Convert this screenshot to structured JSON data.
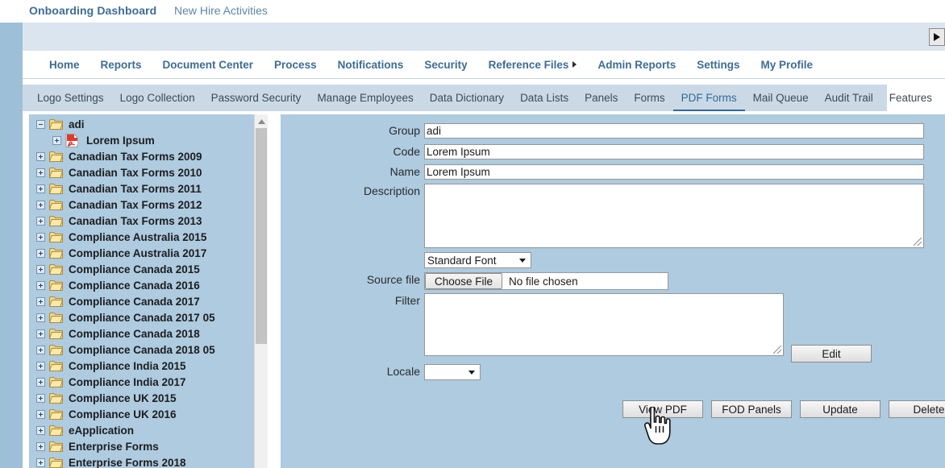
{
  "titlebar": {
    "app_title": "Onboarding Dashboard",
    "secondary_title": "New Hire Activities",
    "scroll_right_icon": "play-right-icon"
  },
  "main_nav": {
    "items": [
      {
        "label": "Home",
        "has_caret": false
      },
      {
        "label": "Reports",
        "has_caret": false
      },
      {
        "label": "Document Center",
        "has_caret": false
      },
      {
        "label": "Process",
        "has_caret": false
      },
      {
        "label": "Notifications",
        "has_caret": false
      },
      {
        "label": "Security",
        "has_caret": false
      },
      {
        "label": "Reference Files",
        "has_caret": true
      },
      {
        "label": "Admin Reports",
        "has_caret": false
      },
      {
        "label": "Settings",
        "has_caret": false
      },
      {
        "label": "My Profile",
        "has_caret": false
      }
    ]
  },
  "sub_tabs": {
    "active": "PDF Forms",
    "items": [
      "Logo Settings",
      "Logo Collection",
      "Password Security",
      "Manage Employees",
      "Data Dictionary",
      "Data Lists",
      "Panels",
      "Forms",
      "PDF Forms",
      "Mail Queue",
      "Audit Trail",
      "Features"
    ]
  },
  "tree": {
    "nodes": [
      {
        "label": "adi",
        "type": "folder",
        "toggle": "minus",
        "indent": 0
      },
      {
        "label": "Lorem Ipsum",
        "type": "pdf",
        "toggle": "plus",
        "indent": 1
      },
      {
        "label": "Canadian Tax Forms 2009",
        "type": "folder",
        "toggle": "plus",
        "indent": 0
      },
      {
        "label": "Canadian Tax Forms 2010",
        "type": "folder",
        "toggle": "plus",
        "indent": 0
      },
      {
        "label": "Canadian Tax Forms 2011",
        "type": "folder",
        "toggle": "plus",
        "indent": 0
      },
      {
        "label": "Canadian Tax Forms 2012",
        "type": "folder",
        "toggle": "plus",
        "indent": 0
      },
      {
        "label": "Canadian Tax Forms 2013",
        "type": "folder",
        "toggle": "plus",
        "indent": 0
      },
      {
        "label": "Compliance Australia 2015",
        "type": "folder",
        "toggle": "plus",
        "indent": 0
      },
      {
        "label": "Compliance Australia 2017",
        "type": "folder",
        "toggle": "plus",
        "indent": 0
      },
      {
        "label": "Compliance Canada 2015",
        "type": "folder",
        "toggle": "plus",
        "indent": 0
      },
      {
        "label": "Compliance Canada 2016",
        "type": "folder",
        "toggle": "plus",
        "indent": 0
      },
      {
        "label": "Compliance Canada 2017",
        "type": "folder",
        "toggle": "plus",
        "indent": 0
      },
      {
        "label": "Compliance Canada 2017 05",
        "type": "folder",
        "toggle": "plus",
        "indent": 0
      },
      {
        "label": "Compliance Canada 2018",
        "type": "folder",
        "toggle": "plus",
        "indent": 0
      },
      {
        "label": "Compliance Canada 2018 05",
        "type": "folder",
        "toggle": "plus",
        "indent": 0
      },
      {
        "label": "Compliance India 2015",
        "type": "folder",
        "toggle": "plus",
        "indent": 0
      },
      {
        "label": "Compliance India 2017",
        "type": "folder",
        "toggle": "plus",
        "indent": 0
      },
      {
        "label": "Compliance UK 2015",
        "type": "folder",
        "toggle": "plus",
        "indent": 0
      },
      {
        "label": "Compliance UK 2016",
        "type": "folder",
        "toggle": "plus",
        "indent": 0
      },
      {
        "label": "eApplication",
        "type": "folder",
        "toggle": "plus",
        "indent": 0
      },
      {
        "label": "Enterprise Forms",
        "type": "folder",
        "toggle": "plus",
        "indent": 0
      },
      {
        "label": "Enterprise Forms 2018",
        "type": "folder",
        "toggle": "plus",
        "indent": 0
      }
    ],
    "scrollbar": {
      "up_arrow_icon": "triangle-up-icon"
    }
  },
  "form": {
    "group_label": "Group",
    "group_value": "adi",
    "code_label": "Code",
    "code_value": "Lorem Ipsum",
    "name_label": "Name",
    "name_value": "Lorem Ipsum",
    "description_label": "Description",
    "description_value": "",
    "font_select_value": "Standard Font",
    "font_select_options": [
      "Standard Font"
    ],
    "source_file_label": "Source file",
    "choose_file_label": "Choose File",
    "no_file_text": "No file chosen",
    "filter_label": "Filter",
    "filter_value": "",
    "edit_button": "Edit",
    "locale_label": "Locale",
    "locale_value": "",
    "locale_options": [
      ""
    ],
    "buttons": [
      {
        "label": "View PDF"
      },
      {
        "label": "FOD Panels"
      },
      {
        "label": "Update"
      },
      {
        "label": "Delete"
      }
    ]
  },
  "cursor": {
    "type": "pointing-hand-cursor"
  },
  "colors": {
    "panel_blue": "#aecbe0",
    "rail_blue": "#9dbfd8",
    "banner_blue": "#dbe5ef",
    "subtab_bar": "#cbd9e6",
    "nav_text": "#3c6d96",
    "active_tab": "#2f6b99"
  }
}
